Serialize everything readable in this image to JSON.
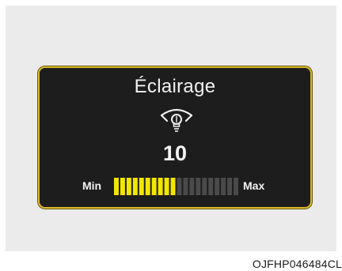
{
  "display": {
    "title": "Éclairage",
    "icon": "dashboard-illumination-icon",
    "value": "10",
    "min_label": "Min",
    "max_label": "Max",
    "level": {
      "current": 10,
      "total": 20
    },
    "colors": {
      "border": "#d8b928",
      "panel": "#1d1d1d",
      "segment_active": "#f2e600",
      "segment_inactive": "#4a4a4a",
      "text": "#f2f2f2"
    }
  },
  "caption": "OJFHP046484CL"
}
